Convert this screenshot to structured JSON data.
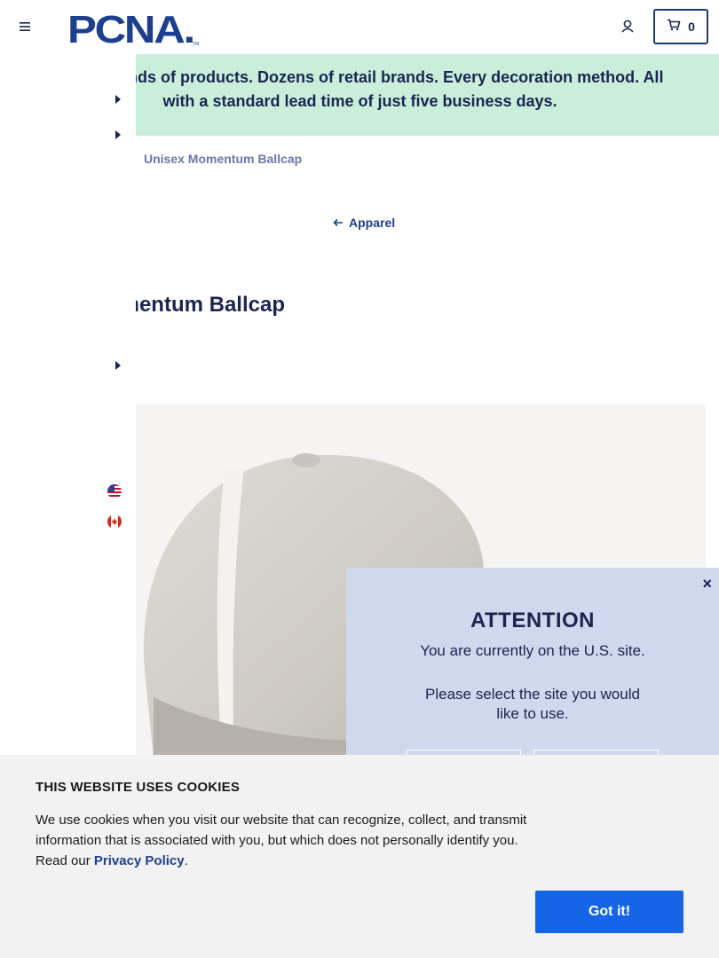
{
  "header": {
    "logo_text": "PCNA",
    "cart_count": "0"
  },
  "promo": {
    "line1": "usands of products. Dozens of retail brands. Every decoration method. All",
    "line2": "with a standard lead time of just five business days."
  },
  "breadcrumb": {
    "current": "Unisex Momentum Ballcap"
  },
  "back_link": {
    "label": "Apparel"
  },
  "product": {
    "title_partial": "mentum Ballcap",
    "image_description_icon": "ballcap-image"
  },
  "flags": [
    "us-flag-icon",
    "canada-flag-icon"
  ],
  "attention_modal": {
    "close_label": "×",
    "title": "ATTENTION",
    "message1": "You are currently on the U.S. site.",
    "message2": "Please select the site you would like to use."
  },
  "cookie_banner": {
    "title": "THIS WEBSITE USES COOKIES",
    "text_before_link": "We use cookies when you visit our website that can recognize, collect, and transmit information that is associated with you, but which does not personally identify you. Read our ",
    "link_label": "Privacy Policy",
    "text_after_link": ".",
    "button_label": "Got it!"
  },
  "colors": {
    "navy": "#1a2550",
    "brand_blue": "#1d3f8f",
    "promo_bg": "#c9efdb",
    "modal_bg": "#cfd9ee",
    "cookie_button": "#1565e6"
  }
}
